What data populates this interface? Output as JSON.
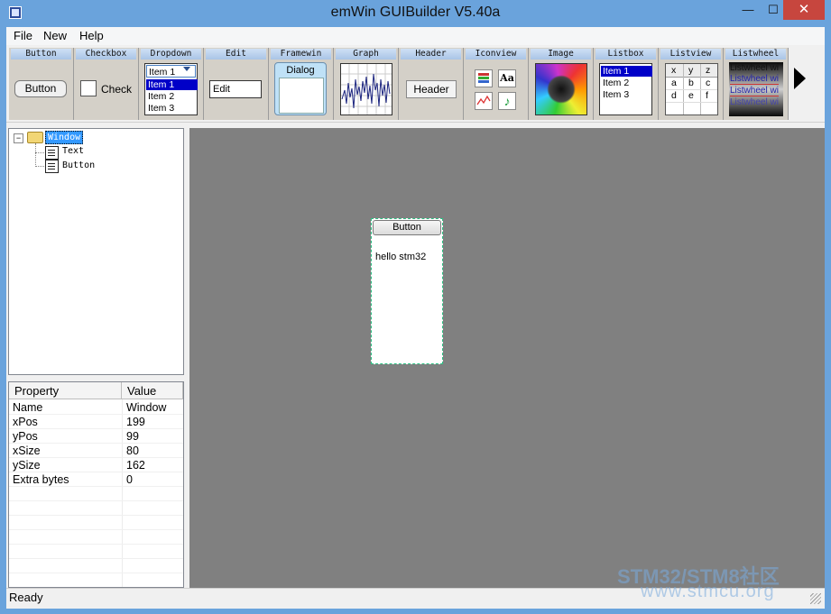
{
  "window": {
    "title": "emWin GUIBuilder V5.40a",
    "min_label": "—",
    "max_label": "☐",
    "close_label": "✕"
  },
  "menu": [
    "File",
    "New",
    "Help"
  ],
  "toolbar": {
    "headers": [
      "Button",
      "Checkbox",
      "Dropdown",
      "Edit",
      "Framewin",
      "Graph",
      "Header",
      "Iconview",
      "Image",
      "Listbox",
      "Listview",
      "Listwheel"
    ],
    "button_preview": "Button",
    "checkbox_preview": "Check",
    "dropdown_selected": "Item 1",
    "dropdown_items": [
      "Item 1",
      "Item 2",
      "Item 3"
    ],
    "edit_preview": "Edit",
    "framewin_preview": "Dialog",
    "header_preview": "Header",
    "iconview_aa": "Aa",
    "listbox_items": [
      "Item 1",
      "Item 2",
      "Item 3"
    ],
    "listview_cells": [
      [
        "x",
        "y",
        "z"
      ],
      [
        "a",
        "b",
        "c"
      ],
      [
        "d",
        "e",
        "f"
      ]
    ],
    "listwheel_items": [
      "Listwheel wi",
      "Listwheel wi",
      "Listwheel wi",
      "Listwheel wi"
    ]
  },
  "tree": {
    "root": "Window",
    "children": [
      "Text",
      "Button"
    ]
  },
  "properties": {
    "headers": [
      "Property",
      "Value"
    ],
    "rows": [
      {
        "name": "Name",
        "value": "Window"
      },
      {
        "name": "xPos",
        "value": "199"
      },
      {
        "name": "yPos",
        "value": "99"
      },
      {
        "name": "xSize",
        "value": "80"
      },
      {
        "name": "ySize",
        "value": "162"
      },
      {
        "name": "Extra bytes",
        "value": "0"
      }
    ]
  },
  "design": {
    "button_label": "Button",
    "text_label": "hello stm32"
  },
  "status": "Ready",
  "watermark": {
    "line1": "STM32/STM8社区",
    "line2": "www.stmcu.org"
  }
}
